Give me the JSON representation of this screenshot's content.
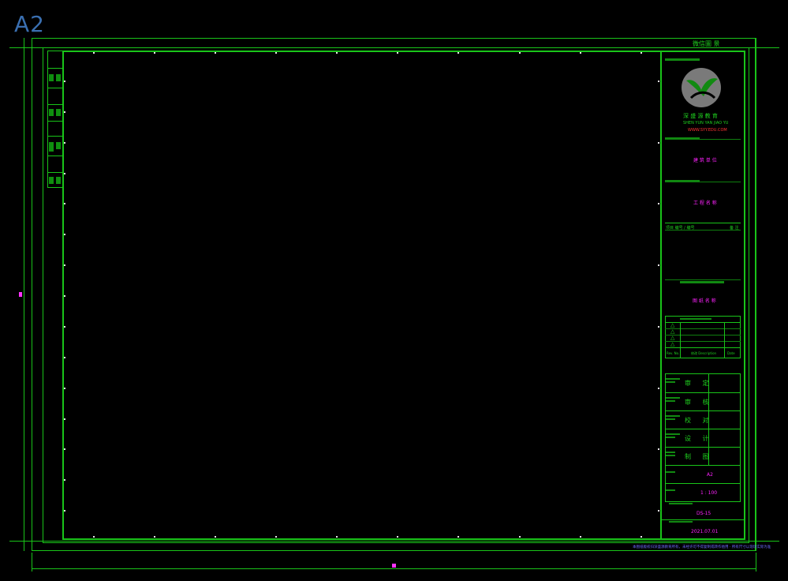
{
  "sheet_size_label": "A2",
  "header_title": "微信圖 景",
  "company": {
    "name_cn": "深 盛 源 教 育",
    "name_en": "SHEN YUN YAN JIAO YU",
    "contact": "WWW.SYY.EDU.COM"
  },
  "project": {
    "label": "建 筑 单 位",
    "subject": "工 程 名 称",
    "number_left": "项目 编号 / 编号",
    "number_right": "备 注"
  },
  "drawing_title": "图 纸 名 称",
  "revisions": {
    "rows": [
      "△",
      "△",
      "△",
      "△"
    ],
    "col_headers": [
      "Rev. No.",
      "修改 Description",
      "Date"
    ]
  },
  "signoff": {
    "rows": [
      "审 定",
      "审 核",
      "校 对",
      "设 计",
      "制 图"
    ]
  },
  "sheet_info": {
    "size": "A2",
    "scale": "1 : 100",
    "sheet_no": "DS-15",
    "date": "2021.07.01"
  },
  "bottom_note": "本图纸版权归深盛源教育所有，未经许可不得复制或转作他用 · 所有尺寸以现场实际为准"
}
